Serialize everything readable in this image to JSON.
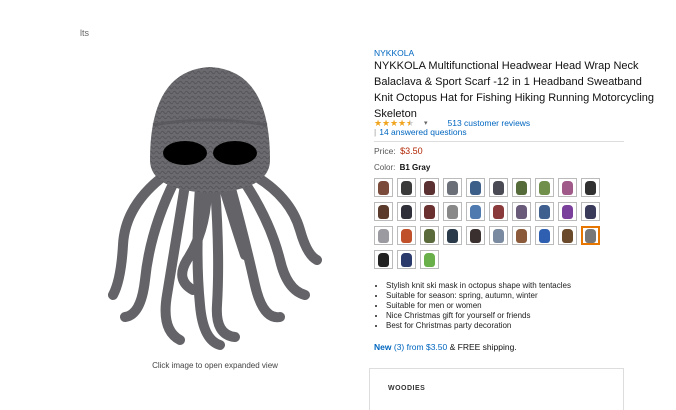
{
  "page": {
    "fragment_text": "lts"
  },
  "image": {
    "caption": "Click image to open expanded view"
  },
  "product": {
    "brand": "NYKKOLA",
    "title": "NYKKOLA Multifunctional Headwear Head Wrap Neck Balaclava & Sport Scarf -12 in 1 Headband Sweatband Knit Octopus Hat for Fishing Hiking Running Motorcycling Skeleton",
    "rating": 4.5,
    "reviews_link": "513 customer reviews",
    "answered_link": "14 answered questions",
    "price_label": "Price:",
    "price": "$3.50",
    "color_label": "Color:",
    "color_value": "B1 Gray"
  },
  "swatches": [
    {
      "color": "#7a4a3a",
      "selected": false
    },
    {
      "color": "#3a3a3a",
      "selected": false
    },
    {
      "color": "#5b3030",
      "selected": false
    },
    {
      "color": "#6a6f78",
      "selected": false
    },
    {
      "color": "#3c5f8a",
      "selected": false
    },
    {
      "color": "#4a4a55",
      "selected": false
    },
    {
      "color": "#556b3a",
      "selected": false
    },
    {
      "color": "#6f8f4a",
      "selected": false
    },
    {
      "color": "#a05a8a",
      "selected": false
    },
    {
      "color": "#303030",
      "selected": false
    },
    {
      "color": "#5a3a2a",
      "selected": false
    },
    {
      "color": "#2f2f3a",
      "selected": false
    },
    {
      "color": "#6a2f2f",
      "selected": false
    },
    {
      "color": "#888888",
      "selected": false
    },
    {
      "color": "#4f7ab0",
      "selected": false
    },
    {
      "color": "#8a3a3a",
      "selected": false
    },
    {
      "color": "#6a5a7a",
      "selected": false
    },
    {
      "color": "#3f5f8f",
      "selected": false
    },
    {
      "color": "#7a3f9a",
      "selected": false
    },
    {
      "color": "#3a3a5a",
      "selected": false
    },
    {
      "color": "#9a9aa0",
      "selected": false
    },
    {
      "color": "#c0502a",
      "selected": false
    },
    {
      "color": "#5a6a3a",
      "selected": false
    },
    {
      "color": "#2a3a4a",
      "selected": false
    },
    {
      "color": "#3a3030",
      "selected": false
    },
    {
      "color": "#7a8aa0",
      "selected": false
    },
    {
      "color": "#8a5a3a",
      "selected": false
    },
    {
      "color": "#2f5fb0",
      "selected": false
    },
    {
      "color": "#6a4a2a",
      "selected": false
    },
    {
      "color": "#777777",
      "selected": true
    },
    {
      "color": "#222222",
      "selected": false
    },
    {
      "color": "#2a3a6a",
      "selected": false
    },
    {
      "color": "#6ab04a",
      "selected": false
    }
  ],
  "bullets": [
    "Stylish knit ski mask in octopus shape with tentacles",
    "Suitable for season: spring, autumn, winter",
    "Suitable for men or women",
    "Nice Christmas gift for yourself or friends",
    "Best for Christmas party decoration"
  ],
  "offers": {
    "new_label": "New",
    "new_count_text": "(3) from $3.50",
    "shipping_text": "& FREE shipping."
  },
  "box_label": "WOODIES"
}
